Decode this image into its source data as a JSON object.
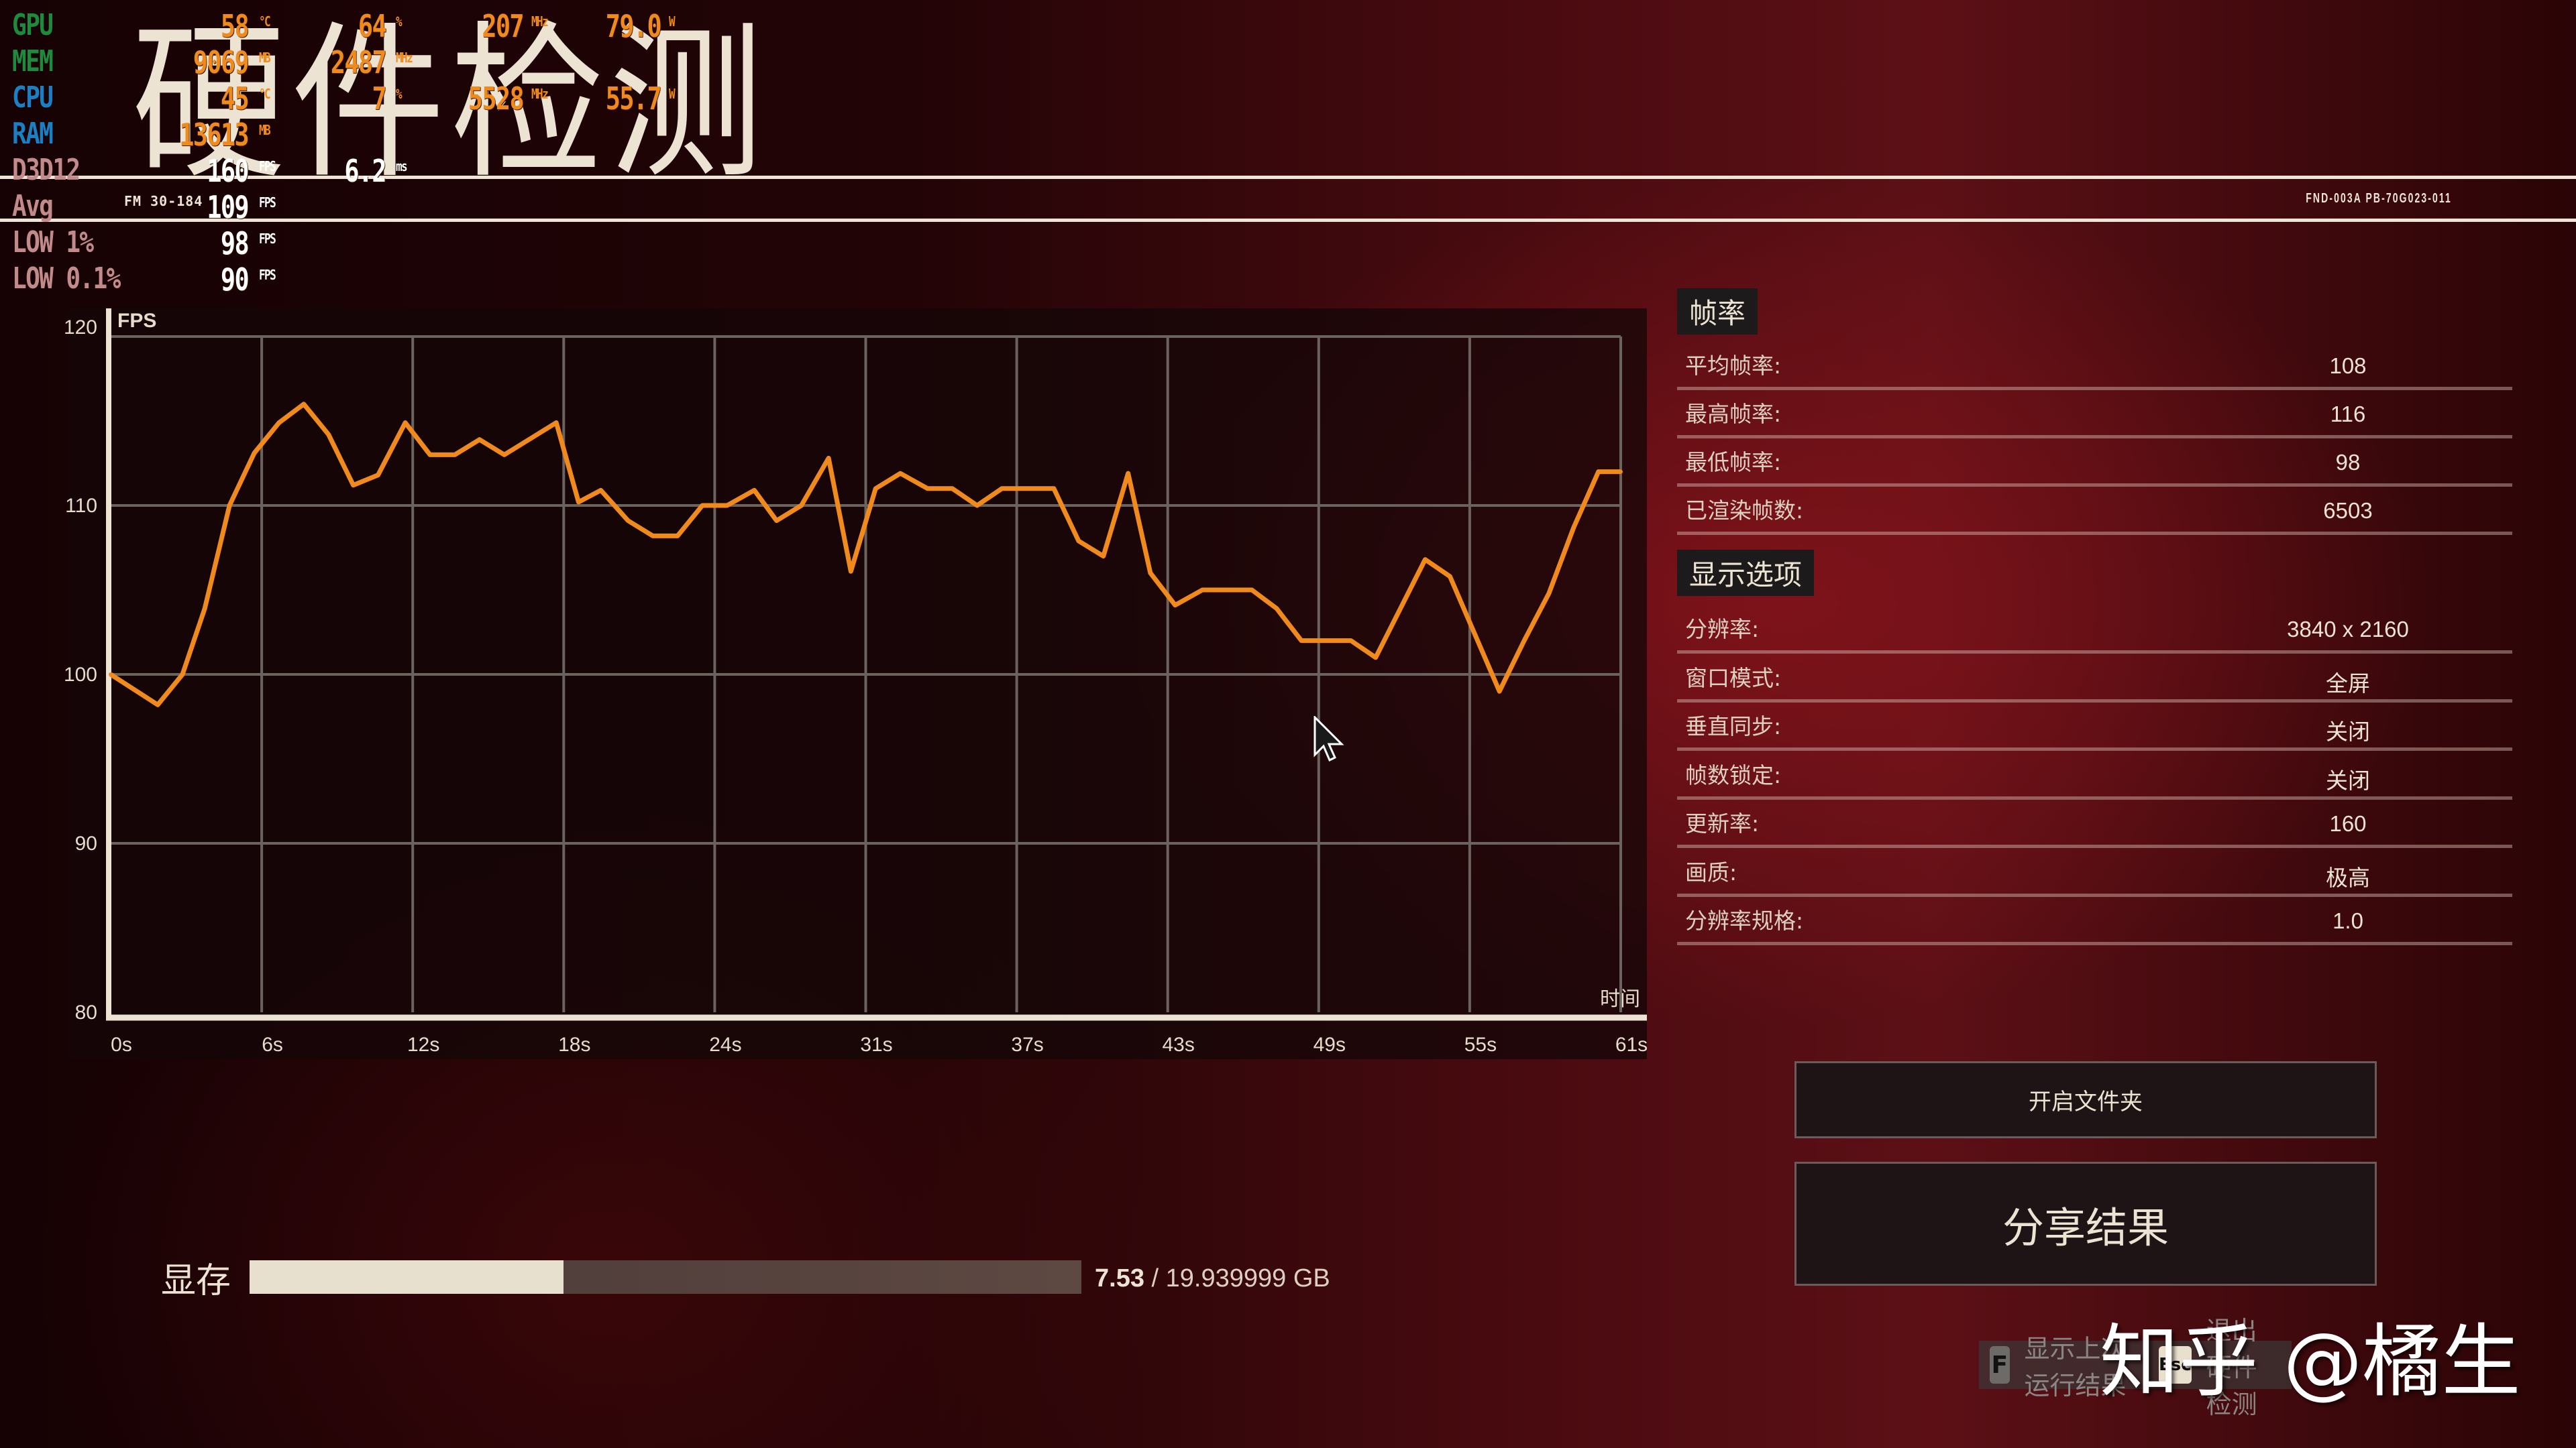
{
  "header": {
    "title": "硬件检测",
    "code": "FND-003A PB-70G023-011"
  },
  "osd": {
    "gpu": {
      "label": "GPU",
      "temp": "58",
      "temp_unit": "°C",
      "load": "64",
      "load_unit": "%",
      "clock": "207",
      "clock_unit": "MHz",
      "power": "79.0",
      "power_unit": "W",
      "color": "#1e8a3c"
    },
    "mem": {
      "label": "MEM",
      "used": "9069",
      "used_unit": "MB",
      "clock": "2487",
      "clock_unit": "MHz",
      "color": "#1e8a3c"
    },
    "cpu": {
      "label": "CPU",
      "temp": "45",
      "temp_unit": "°C",
      "load": "7",
      "load_unit": "%",
      "clock": "5528",
      "clock_unit": "MHz",
      "power": "55.7",
      "power_unit": "W",
      "color": "#1b7fc4"
    },
    "ram": {
      "label": "RAM",
      "used": "13613",
      "used_unit": "MB",
      "color": "#1b7fc4"
    },
    "d3d12": {
      "label": "D3D12",
      "fps": "160",
      "fps_unit": "FPS",
      "frametime": "6.2",
      "frametime_unit": "ms"
    },
    "avg": {
      "label": "Avg",
      "range": "FM 30-184",
      "fps": "109",
      "fps_unit": "FPS"
    },
    "low1": {
      "label": "LOW 1%",
      "fps": "98",
      "fps_unit": "FPS"
    },
    "low01": {
      "label": "LOW 0.1%",
      "fps": "90",
      "fps_unit": "FPS"
    },
    "label_color": "#c28a8a",
    "value_color": "#f08a1c"
  },
  "chart_data": {
    "type": "line",
    "title": "",
    "ylabel": "FPS",
    "xlabel": "时间",
    "ylim": [
      80,
      120
    ],
    "xlim": [
      0,
      61
    ],
    "y_ticks": [
      120,
      110,
      100,
      90,
      80
    ],
    "x_tick_labels": [
      "0s",
      "6s",
      "12s",
      "18s",
      "24s",
      "31s",
      "37s",
      "43s",
      "49s",
      "55s",
      "61s"
    ],
    "x_tick_values": [
      0,
      6.1,
      12.2,
      18.3,
      24.4,
      30.5,
      36.6,
      42.7,
      48.8,
      54.9,
      61
    ],
    "grid": true,
    "line_color": "#f08a1c",
    "series": [
      {
        "name": "FPS",
        "x": [
          0,
          1.9,
          2.9,
          3.8,
          4.8,
          5.8,
          6.8,
          7.8,
          8.8,
          9.8,
          10.8,
          11.9,
          12.9,
          13.9,
          14.9,
          15.9,
          18.0,
          18.9,
          19.8,
          20.9,
          21.9,
          22.9,
          23.9,
          24.9,
          26.0,
          26.9,
          27.9,
          29.0,
          29.9,
          30.9,
          31.9,
          33.0,
          34.0,
          35.0,
          36.0,
          38.1,
          39.1,
          40.1,
          41.1,
          42.0,
          43.0,
          44.1,
          46.1,
          47.1,
          48.1,
          50.1,
          51.1,
          53.1,
          54.1,
          56.1,
          57.1,
          58.1,
          59.1,
          60.1,
          61.0
        ],
        "values": [
          100,
          98.2,
          100,
          103.9,
          110,
          113.1,
          114.9,
          116,
          114.2,
          111.2,
          111.8,
          114.9,
          113,
          113,
          113.9,
          113,
          114.9,
          110.2,
          110.9,
          109.1,
          108.2,
          108.2,
          110,
          110,
          110.9,
          109.1,
          110,
          112.8,
          106.1,
          111,
          111.9,
          111,
          111,
          110,
          111,
          111,
          107.9,
          107,
          111.9,
          106,
          104.1,
          105,
          105,
          103.9,
          102,
          102,
          101,
          106.8,
          105.8,
          99,
          102,
          104.8,
          108.7,
          112,
          112
        ]
      }
    ]
  },
  "framerate": {
    "title": "帧率",
    "rows": [
      {
        "label": "平均帧率:",
        "value": "108"
      },
      {
        "label": "最高帧率:",
        "value": "116"
      },
      {
        "label": "最低帧率:",
        "value": "98"
      },
      {
        "label": "已渲染帧数:",
        "value": "6503"
      }
    ]
  },
  "display": {
    "title": "显示选项",
    "rows": [
      {
        "label": "分辨率:",
        "value": "3840 x 2160"
      },
      {
        "label": "窗口模式:",
        "value": "全屏"
      },
      {
        "label": "垂直同步:",
        "value": "关闭"
      },
      {
        "label": "帧数锁定:",
        "value": "关闭"
      },
      {
        "label": "更新率:",
        "value": "160"
      },
      {
        "label": "画质:",
        "value": "极高"
      },
      {
        "label": "分辨率规格:",
        "value": "1.0"
      }
    ]
  },
  "buttons": {
    "open_folder": "开启文件夹",
    "share": "分享结果"
  },
  "vram": {
    "label": "显存",
    "used": "7.53",
    "total": "/ 19.939999 GB",
    "fraction": 0.3776
  },
  "hints": {
    "last_run_key": "F",
    "last_run_label": "显示上次运行结果",
    "exit_key": "Esc",
    "exit_label": "退出硬件检测"
  },
  "watermark": "知乎 @橘生"
}
